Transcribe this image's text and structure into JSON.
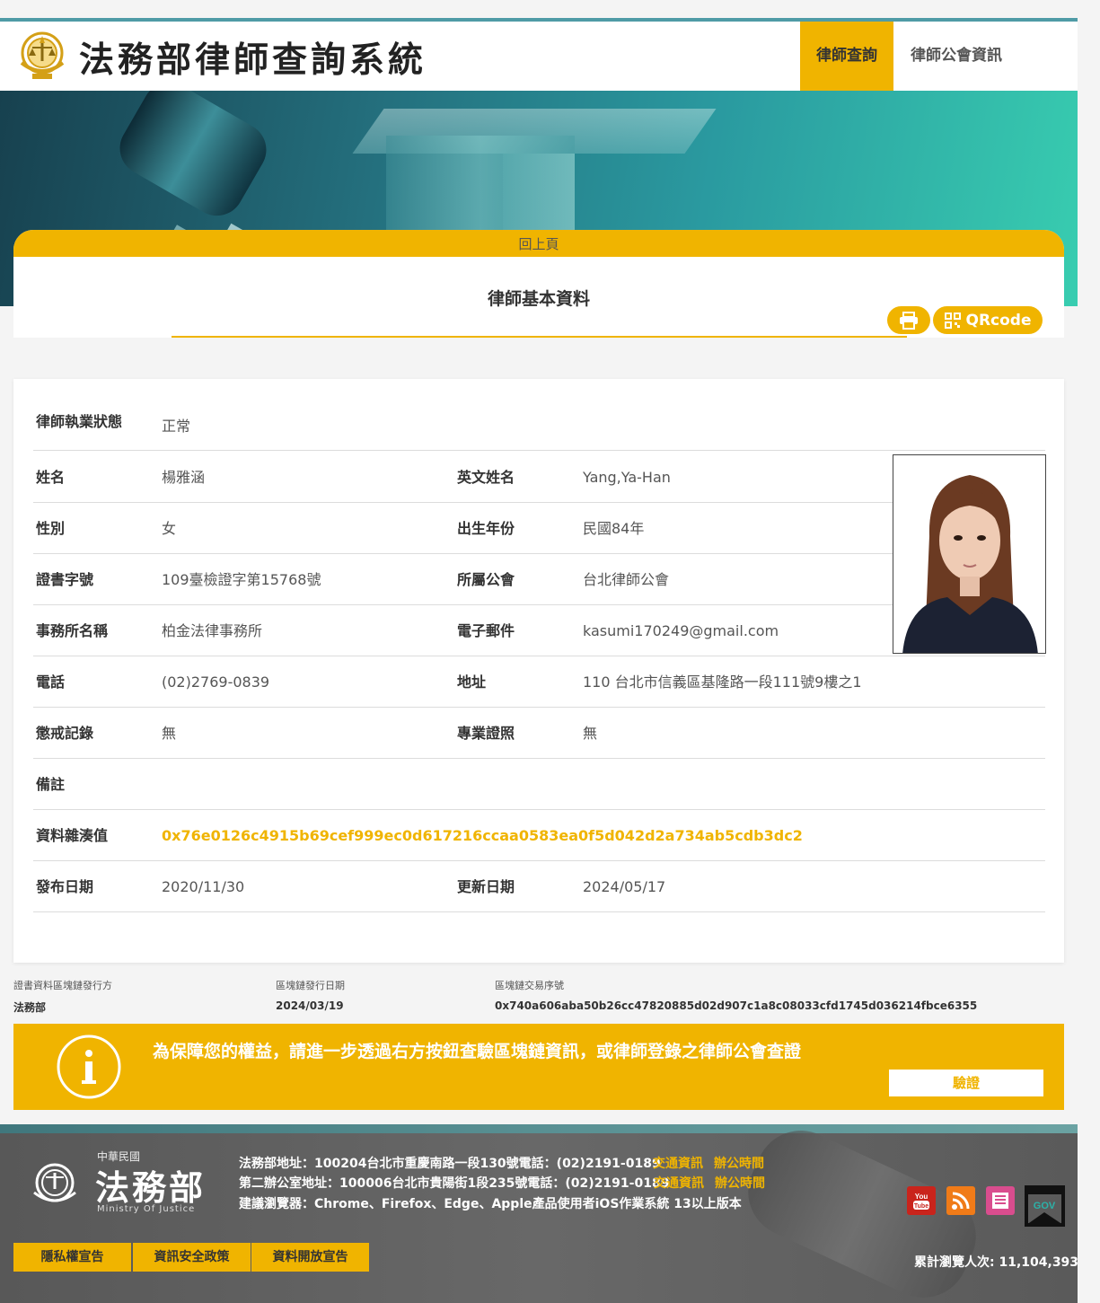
{
  "header": {
    "site_title": "法務部律師查詢系統",
    "nav_tabs": [
      {
        "label": "律師查詢",
        "active": true
      },
      {
        "label": "律師公會資訊",
        "active": false
      }
    ]
  },
  "card": {
    "back_label": "回上頁",
    "title": "律師基本資料",
    "qrcode_label": "QRcode"
  },
  "info": {
    "status": {
      "label": "律師執業狀態",
      "value": "正常"
    },
    "rows": [
      {
        "label1": "姓名",
        "value1": "楊雅涵",
        "label2": "英文姓名",
        "value2": "Yang,Ya-Han"
      },
      {
        "label1": "性別",
        "value1": "女",
        "label2": "出生年份",
        "value2": "民國84年"
      },
      {
        "label1": "證書字號",
        "value1": "109臺檢證字第15768號",
        "label2": "所屬公會",
        "value2": "台北律師公會"
      },
      {
        "label1": "事務所名稱",
        "value1": "柏金法律事務所",
        "label2": "電子郵件",
        "value2": "kasumi170249@gmail.com"
      },
      {
        "label1": "電話",
        "value1": "(02)2769-0839",
        "label2": "地址",
        "value2": "110 台北市信義區基隆路一段111號9樓之1"
      },
      {
        "label1": "懲戒記錄",
        "value1": "無",
        "label2": "專業證照",
        "value2": "無"
      }
    ],
    "remark": {
      "label": "備註",
      "value": ""
    },
    "hash": {
      "label": "資料雜湊值",
      "value": "0x76e0126c4915b69cef999ec0d617216ccaa0583ea0f5d042d2a734ab5cdb3dc2"
    },
    "dates": {
      "label1": "發布日期",
      "value1": "2020/11/30",
      "label2": "更新日期",
      "value2": "2024/05/17"
    }
  },
  "blockchain": {
    "issuer_label": "證書資料區塊鏈發行方",
    "issuer_value": "法務部",
    "date_label": "區塊鏈發行日期",
    "date_value": "2024/03/19",
    "tx_label": "區塊鏈交易序號",
    "tx_value": "0x740a606aba50b26cc47820885d02d907c1a8c08033cfd1745d036214fbce6355"
  },
  "notice": {
    "text": "為保障您的權益，請進一步透過右方按鈕查驗區塊鏈資訊，或律師登錄之律師公會查證",
    "verify_label": "驗證"
  },
  "footer": {
    "roc": "中華民國",
    "ministry": "法務部",
    "ministry_en": "Ministry Of Justice",
    "address1": "法務部地址：100204台北市重慶南路一段130號電話：(02)2191-0189",
    "address2": "第二辦公室地址：100006台北市貴陽街1段235號電話：(02)2191-0189",
    "browsers": "建議瀏覽器：Chrome、Firefox、Edge、Apple產品使用者iOS作業系統 13以上版本",
    "traffic_label": "交通資訊",
    "hours_label": "辦公時間",
    "buttons": [
      "隱私權宣告",
      "資訊安全政策",
      "資料開放宣告"
    ],
    "visits": "累計瀏覽人次: 11,104,393",
    "icons": [
      "youtube-icon",
      "rss-icon",
      "newsletter-icon",
      "gov-icon"
    ],
    "accent_color": "#f0b400"
  }
}
